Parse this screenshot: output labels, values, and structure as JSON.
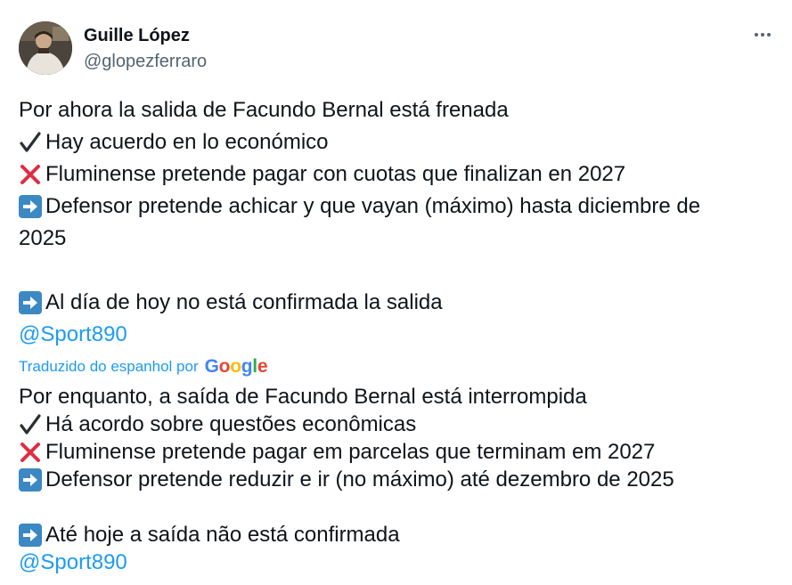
{
  "author": {
    "name": "Guille López",
    "handle": "@glopezferraro",
    "avatar": "avatar-photo"
  },
  "more_icon": "more-horizontal-icon",
  "original": {
    "line1": "Por ahora la salida de Facundo Bernal está frenada",
    "line2": "Hay acuerdo en lo económico",
    "line3": "Fluminense pretende pagar con cuotas que finalizan en 2027",
    "line4a": "Defensor pretende achicar y que vayan (máximo) hasta diciembre de",
    "line4b": "2025",
    "line5": " Al día de hoy no está confirmada la salida",
    "mention": "@Sport890"
  },
  "translation": {
    "label": "Traduzido do espanhol por",
    "provider": "Google",
    "line1": "Por enquanto, a saída de Facundo Bernal está interrompida",
    "line2": " Há acordo sobre questões econômicas",
    "line3": " Fluminense pretende pagar em parcelas que terminam em 2027",
    "line4": " Defensor pretende reduzir e ir (no máximo) até dezembro de 2025",
    "line5": " Até hoje a saída não está confirmada",
    "mention": "@Sport890"
  },
  "icons": {
    "check": "check-mark-icon",
    "cross": "cross-mark-icon",
    "arrow": "right-arrow-icon"
  },
  "colors": {
    "link": "#1d9bf0",
    "text": "#0f1419",
    "secondary": "#536471",
    "cross": "#e0245e",
    "arrow_bg": "#3b88c3"
  }
}
